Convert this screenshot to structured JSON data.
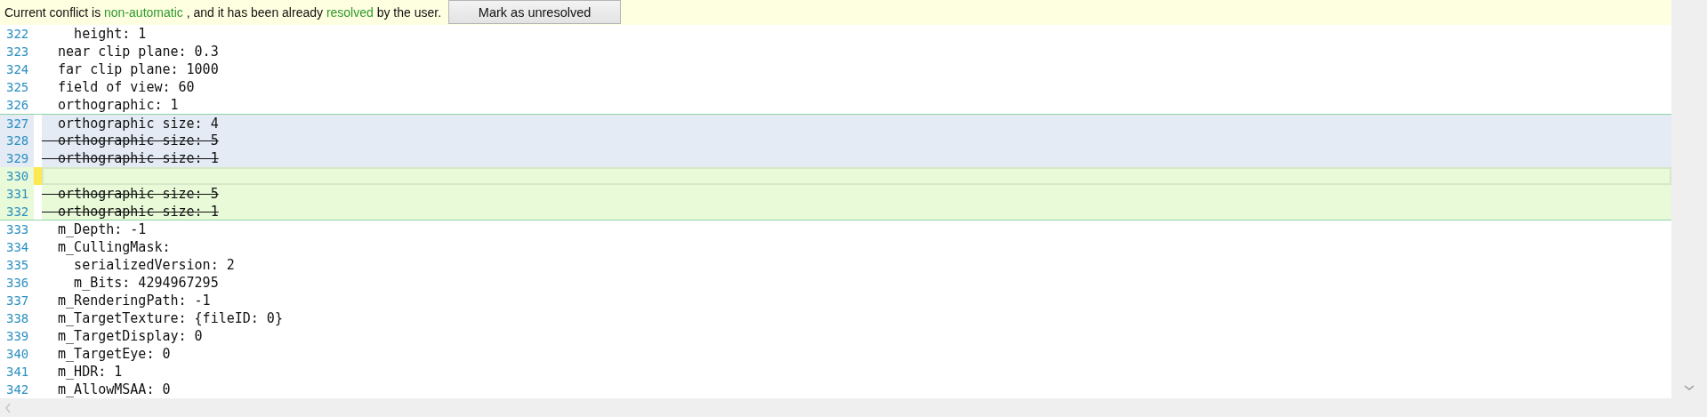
{
  "banner": {
    "message": [
      {
        "text": "Current conflict is ",
        "kind": "plain"
      },
      {
        "text": "non-automatic",
        "kind": "highlight"
      },
      {
        "text": " , and it has been already ",
        "kind": "plain"
      },
      {
        "text": "resolved",
        "kind": "highlight"
      },
      {
        "text": " by the user.",
        "kind": "plain"
      }
    ],
    "button": "Mark as unresolved"
  },
  "lines": [
    {
      "number": "322",
      "text": "    height: 1",
      "kind": "plain",
      "struck": false,
      "current": false
    },
    {
      "number": "323",
      "text": "  near clip plane: 0.3",
      "kind": "plain",
      "struck": false,
      "current": false
    },
    {
      "number": "324",
      "text": "  far clip plane: 1000",
      "kind": "plain",
      "struck": false,
      "current": false
    },
    {
      "number": "325",
      "text": "  field of view: 60",
      "kind": "plain",
      "struck": false,
      "current": false
    },
    {
      "number": "326",
      "text": "  orthographic: 1",
      "kind": "plain",
      "struck": false,
      "current": false
    },
    {
      "number": "327",
      "text": "  orthographic size: 4",
      "kind": "ours",
      "struck": false,
      "current": false
    },
    {
      "number": "328",
      "text": "  orthographic size: 5",
      "kind": "ours",
      "struck": true,
      "current": false
    },
    {
      "number": "329",
      "text": "  orthographic size: 1",
      "kind": "ours",
      "struck": true,
      "current": false
    },
    {
      "number": "330",
      "kind": "theirs",
      "current": true
    },
    {
      "number": "331",
      "text": "  orthographic size: 5",
      "kind": "theirs",
      "struck": true,
      "current": false
    },
    {
      "number": "332",
      "text": "  orthographic size: 1",
      "kind": "theirs",
      "struck": true,
      "current": false
    },
    {
      "number": "333",
      "text": "  m_Depth: -1",
      "kind": "plain",
      "struck": false,
      "current": false
    },
    {
      "number": "334",
      "text": "  m_CullingMask:",
      "kind": "plain",
      "struck": false,
      "current": false
    },
    {
      "number": "335",
      "text": "    serializedVersion: 2",
      "kind": "plain",
      "struck": false,
      "current": false
    },
    {
      "number": "336",
      "text": "    m_Bits: 4294967295",
      "kind": "plain",
      "struck": false,
      "current": false
    },
    {
      "number": "337",
      "text": "  m_RenderingPath: -1",
      "kind": "plain",
      "struck": false,
      "current": false
    },
    {
      "number": "338",
      "text": "  m_TargetTexture: {fileID: 0}",
      "kind": "plain",
      "struck": false,
      "current": false
    },
    {
      "number": "339",
      "text": "  m_TargetDisplay: 0",
      "kind": "plain",
      "struck": false,
      "current": false
    },
    {
      "number": "340",
      "text": "  m_TargetEye: 0",
      "kind": "plain",
      "struck": false,
      "current": false
    },
    {
      "number": "341",
      "text": "  m_HDR: 1",
      "kind": "plain",
      "struck": false,
      "current": false
    },
    {
      "number": "342",
      "text": "  m_AllowMSAA: 0",
      "kind": "plain",
      "struck": false,
      "current": false
    }
  ]
}
